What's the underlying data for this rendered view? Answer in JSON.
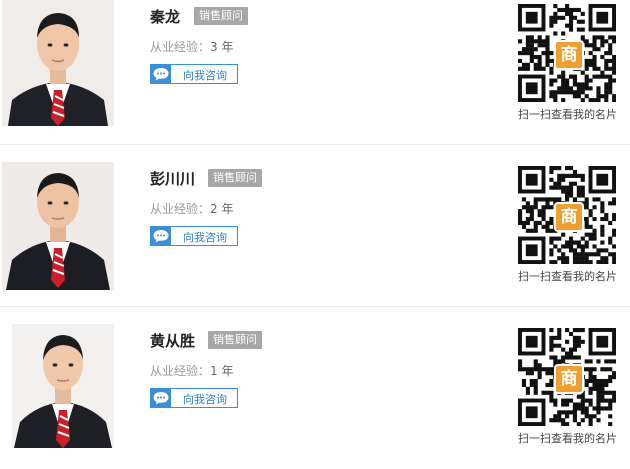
{
  "consultants": [
    {
      "name": "秦龙",
      "title_badge": "销售顾问",
      "experience_label": "从业经验：",
      "experience_value": "3 年",
      "consult_button": "向我咨询",
      "qr_caption": "扫一扫查看我的名片",
      "qr_center_text": "商"
    },
    {
      "name": "彭川川",
      "title_badge": "销售顾问",
      "experience_label": "从业经验：",
      "experience_value": "2 年",
      "consult_button": "向我咨询",
      "qr_caption": "扫一扫查看我的名片",
      "qr_center_text": "商"
    },
    {
      "name": "黄从胜",
      "title_badge": "销售顾问",
      "experience_label": "从业经验：",
      "experience_value": "1 年",
      "consult_button": "向我咨询",
      "qr_caption": "扫一扫查看我的名片",
      "qr_center_text": "商"
    }
  ],
  "colors": {
    "accent_blue": "#3b8ed8",
    "badge_gray": "#a7a7a7",
    "qr_orange": "#f0a032",
    "tie_red": "#c8202a"
  }
}
